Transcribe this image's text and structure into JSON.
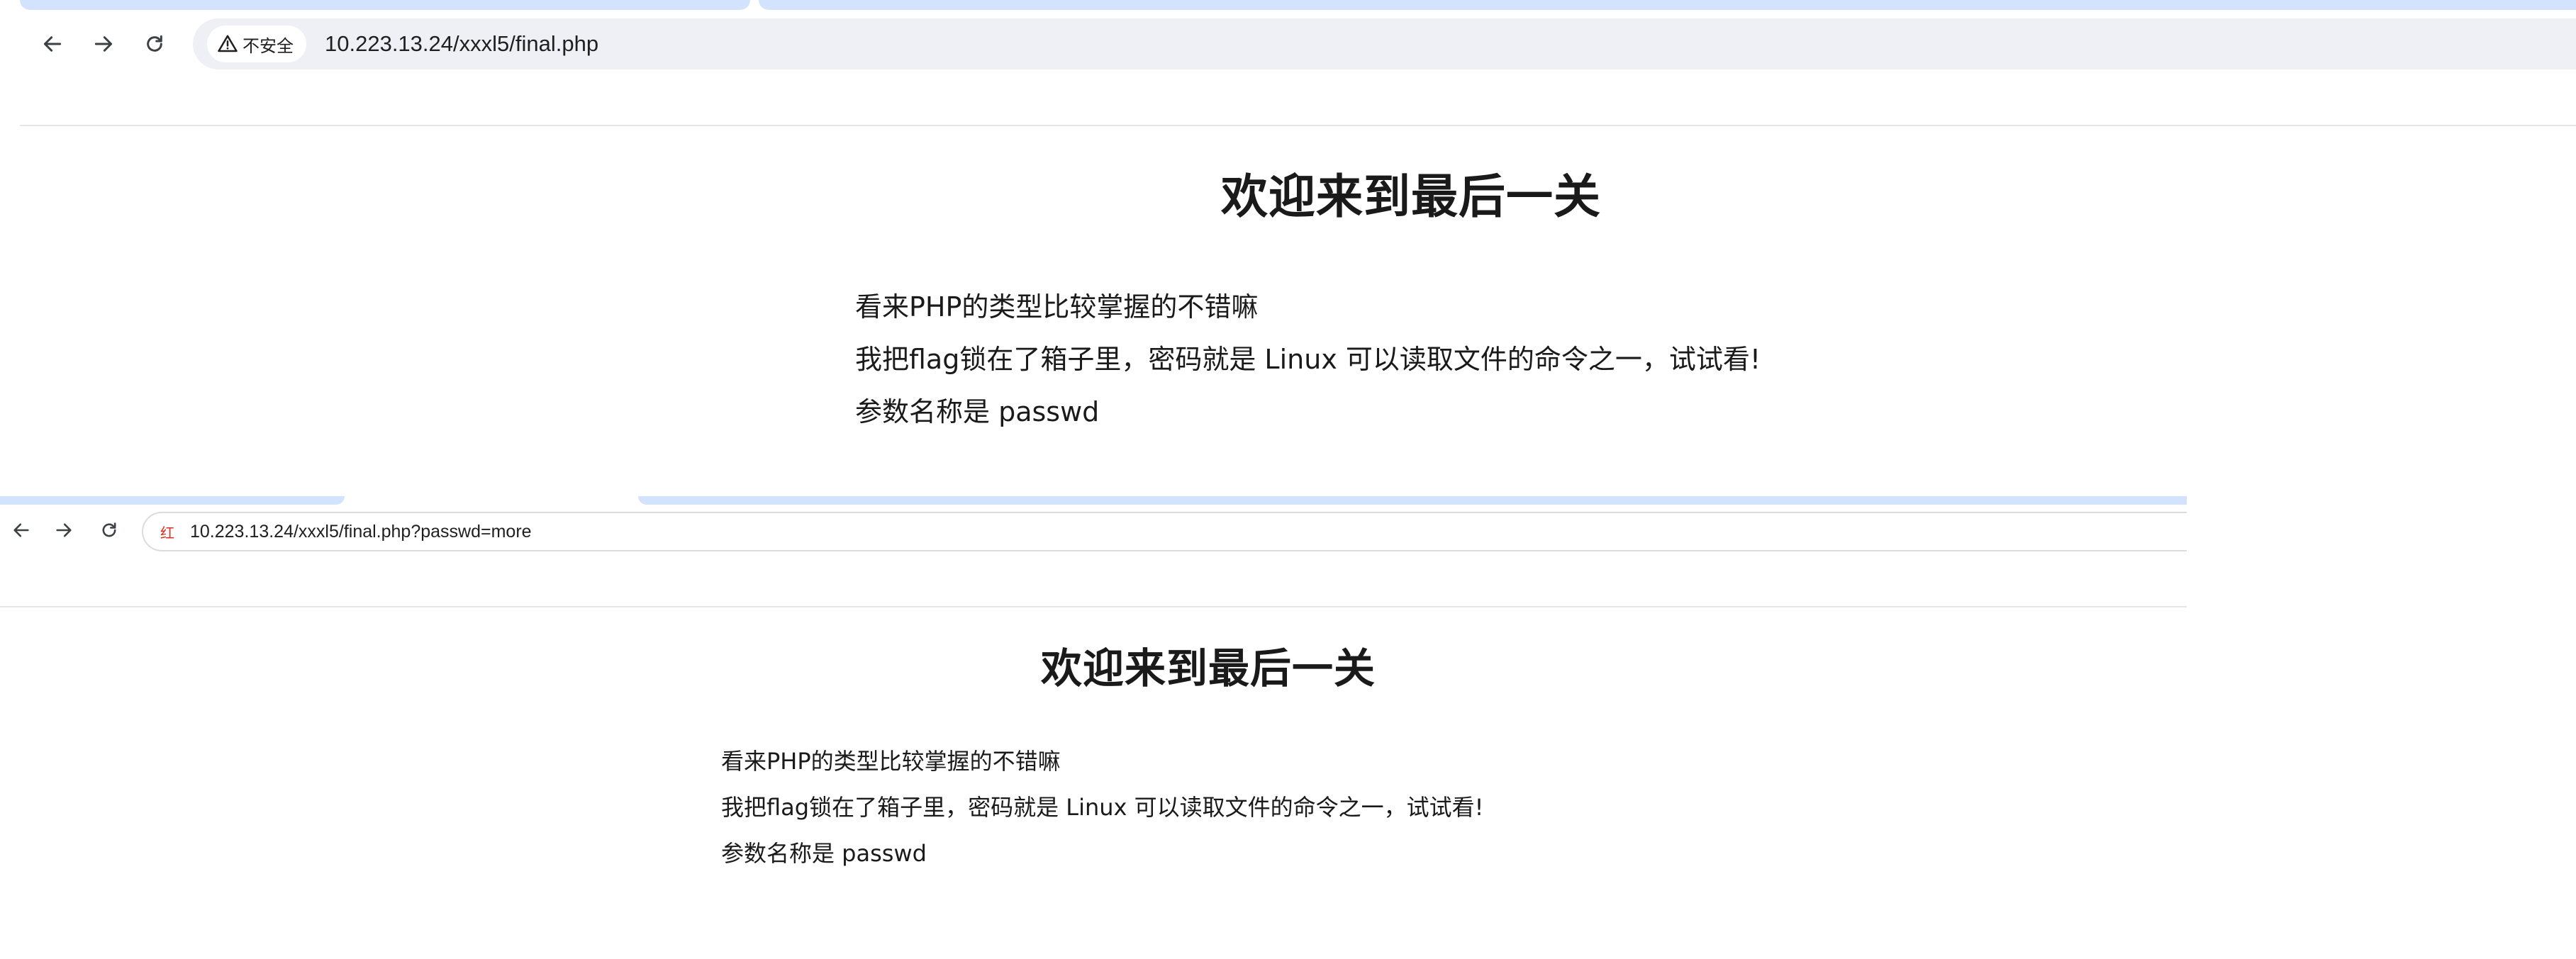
{
  "window1": {
    "security_label": "不安全",
    "url": "10.223.13.24/xxxl5/final.php",
    "page": {
      "title": "欢迎来到最后一关",
      "lines": [
        "看来PHP的类型比较掌握的不错嘛",
        "我把flag锁在了箱子里，密码就是 Linux 可以读取文件的命令之一，试试看!",
        "参数名称是 passwd"
      ]
    }
  },
  "window2": {
    "security_label": "红",
    "url": "10.223.13.24/xxxl5/final.php?passwd=more",
    "page": {
      "title": "欢迎来到最后一关",
      "lines": [
        "看来PHP的类型比较掌握的不错嘛",
        "我把flag锁在了箱子里，密码就是 Linux 可以读取文件的命令之一，试试看!",
        "参数名称是 passwd"
      ]
    }
  },
  "icons": {
    "back": "back-arrow-icon",
    "forward": "forward-arrow-icon",
    "reload": "reload-icon",
    "warning": "warning-triangle-icon"
  },
  "colors": {
    "tab_strip": "#d3e3fd",
    "omnibox_bg": "#eef0f6",
    "warning_red": "#d93025",
    "text": "#1a1a1a"
  }
}
